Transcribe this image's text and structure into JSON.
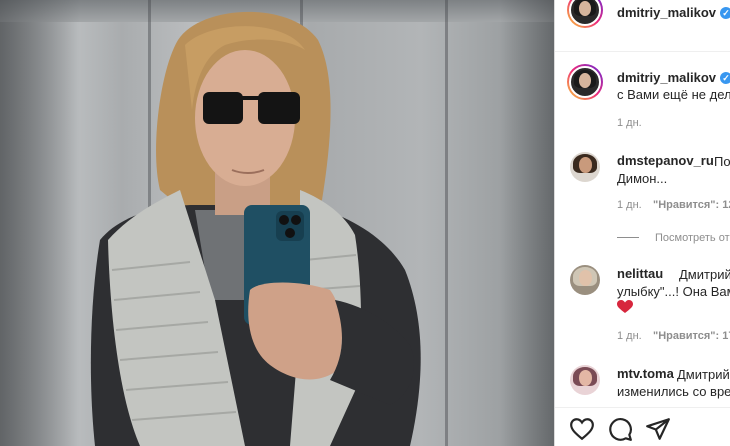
{
  "post": {
    "author": "dmitriy_malikov",
    "caption_author": "dmitriy_malikov",
    "caption_text": "с Вами ещё не дел",
    "caption_time": "1 дн."
  },
  "comments": [
    {
      "username": "dmstepanov_ru",
      "lines": [
        "По",
        "Димон..."
      ],
      "time": "1 дн.",
      "likes": "\"Нравится\": 12"
    },
    {
      "username": "nelittau",
      "lines": [
        "Дмитрий, \"",
        "улыбку\"...! Она Вам"
      ],
      "has_heart": true,
      "time": "1 дн.",
      "likes": "\"Нравится\": 17"
    },
    {
      "username": "mtv.toma",
      "lines": [
        "Дмитрий",
        "изменились со врем"
      ]
    }
  ],
  "view_replies": "Посмотреть от",
  "icons": {
    "verified": "verified-badge-icon",
    "like": "heart-icon",
    "comment": "comment-bubble-icon",
    "share": "paper-plane-icon"
  },
  "colors": {
    "verified": "#3897f0",
    "heart": "#e0245e"
  }
}
